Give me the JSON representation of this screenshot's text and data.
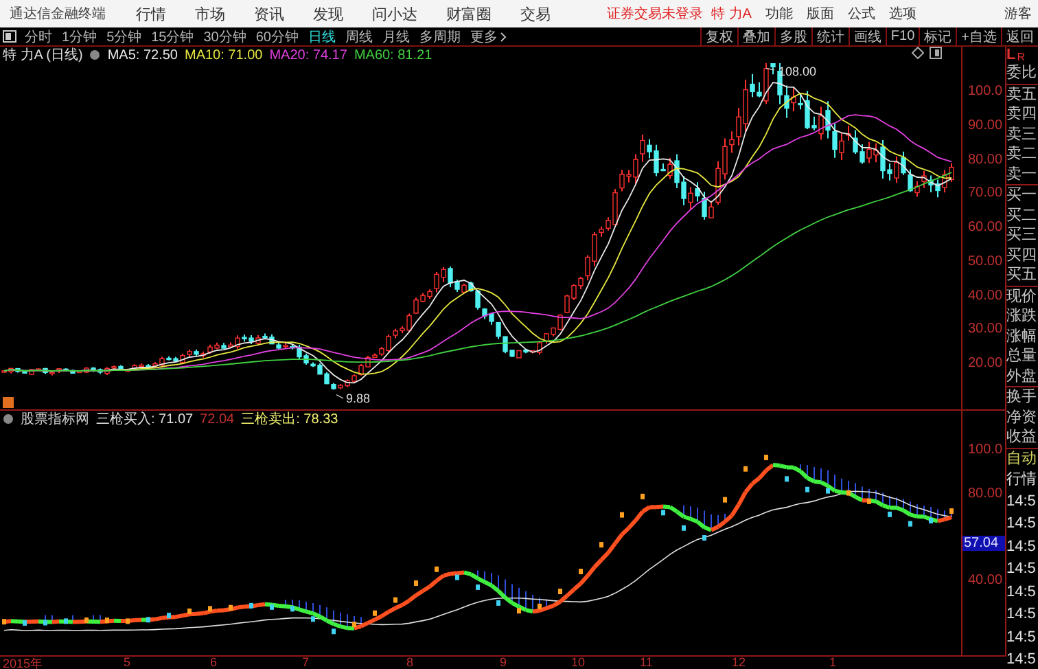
{
  "app": {
    "name": "通达信金融终端",
    "menu": [
      "行情",
      "市场",
      "资讯",
      "发现",
      "问小达",
      "财富圈",
      "交易"
    ],
    "notice": "证券交易未登录",
    "stock": "特 力A",
    "right_menu": [
      "功能",
      "版面",
      "公式",
      "选项"
    ],
    "user": "游客"
  },
  "periods": [
    {
      "label": "分时",
      "selected": false
    },
    {
      "label": "1分钟",
      "selected": false
    },
    {
      "label": "5分钟",
      "selected": false
    },
    {
      "label": "15分钟",
      "selected": false
    },
    {
      "label": "30分钟",
      "selected": false
    },
    {
      "label": "60分钟",
      "selected": false
    },
    {
      "label": "日线",
      "selected": true
    },
    {
      "label": "周线",
      "selected": false
    },
    {
      "label": "月线",
      "selected": false
    },
    {
      "label": "多周期",
      "selected": false
    },
    {
      "label": "更多",
      "selected": false
    }
  ],
  "tools": [
    "复权",
    "叠加",
    "多股",
    "统计",
    "画线",
    "F10",
    "标记",
    "+自选",
    "返回"
  ],
  "price_chart": {
    "title": "特 力A (日线)",
    "ma": [
      {
        "label": "MA5: 72.50",
        "color": "#e8e8e8"
      },
      {
        "label": "MA10: 71.00",
        "color": "#e8e840"
      },
      {
        "label": "MA20: 74.17",
        "color": "#e040e0"
      },
      {
        "label": "MA60: 81.21",
        "color": "#40d040"
      }
    ],
    "yticks": [
      "100.0",
      "90.00",
      "80.00",
      "70.00",
      "60.00",
      "50.00",
      "40.00",
      "30.00",
      "20.00"
    ],
    "high_label": "108.00",
    "low_label": "9.88"
  },
  "indicator": {
    "name": "股票指标网",
    "values": [
      {
        "label": "三枪买入: 71.07",
        "color": "#e0e0e0"
      },
      {
        "label": "72.04",
        "color": "#c03030"
      },
      {
        "label": "三枪卖出: 78.33",
        "color": "#f0f070"
      }
    ],
    "yticks": [
      "100.0",
      "80.00",
      "40.00"
    ],
    "current": "57.04"
  },
  "xaxis": [
    "2015年",
    "5",
    "6",
    "7",
    "8",
    "9",
    "10",
    "11",
    "12",
    "1"
  ],
  "quote_panel": {
    "logo": [
      "L",
      "R"
    ],
    "groups": [
      [
        "委比"
      ],
      [
        "卖五",
        "卖四",
        "卖三",
        "卖二",
        "卖一"
      ],
      [
        "买一",
        "买二",
        "买三",
        "买四",
        "买五"
      ],
      [
        "现价",
        "涨跌",
        "涨幅",
        "总量",
        "外盘"
      ],
      [
        "换手",
        "净资",
        "收益"
      ]
    ],
    "mode": [
      "自动",
      "行情"
    ],
    "times": [
      "14:5",
      "14:5",
      "14:5",
      "14:5",
      "14:5",
      "14:5",
      "14:5",
      "14:5"
    ]
  }
}
